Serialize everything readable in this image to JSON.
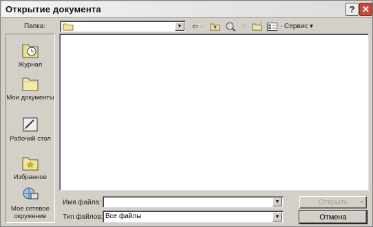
{
  "window": {
    "title": "Открытие документа",
    "help_glyph": "?",
    "close_glyph": "✕"
  },
  "folder": {
    "label": "Папка:",
    "current": ""
  },
  "toolbar": {
    "back_glyph": "⇦ ·",
    "up_glyph": "⬒",
    "search_icon": "search-web-icon",
    "delete_glyph": "✕",
    "service_label": "· Сервис ▾"
  },
  "places": [
    {
      "label": "Журнал",
      "icon": "history-icon"
    },
    {
      "label": "Мои документы",
      "icon": "my-documents-icon"
    },
    {
      "label": "Рабочий стол",
      "icon": "desktop-icon"
    },
    {
      "label": "Избранное",
      "icon": "favorites-icon"
    },
    {
      "label": "Мое сетевое окружение",
      "icon": "network-places-icon"
    }
  ],
  "filename": {
    "label": "Имя файла:",
    "value": ""
  },
  "filetype": {
    "label": "Тип файлов:",
    "value": "Все файлы"
  },
  "buttons": {
    "open": "Открыть",
    "cancel": "Отмена"
  }
}
